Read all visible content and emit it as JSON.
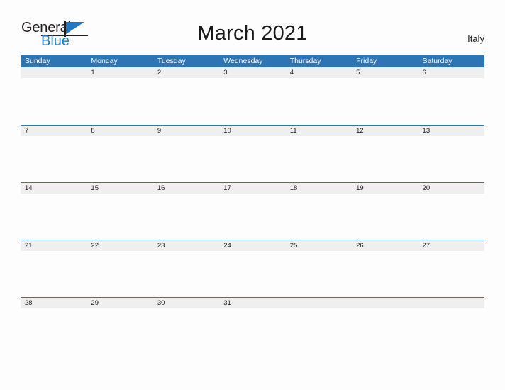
{
  "brand": {
    "word_one": "General",
    "word_two": "Blue",
    "flag_icon": "blue-flag-icon",
    "accent_color": "#1f78c1"
  },
  "header": {
    "title": "March 2021",
    "country": "Italy"
  },
  "calendar": {
    "header_bg": "#2e75b6",
    "date_band_bg": "#efefef",
    "weekdays": [
      "Sunday",
      "Monday",
      "Tuesday",
      "Wednesday",
      "Thursday",
      "Friday",
      "Saturday"
    ],
    "weeks": [
      [
        "",
        "1",
        "2",
        "3",
        "4",
        "5",
        "6"
      ],
      [
        "7",
        "8",
        "9",
        "10",
        "11",
        "12",
        "13"
      ],
      [
        "14",
        "15",
        "16",
        "17",
        "18",
        "19",
        "20"
      ],
      [
        "21",
        "22",
        "23",
        "24",
        "25",
        "26",
        "27"
      ],
      [
        "28",
        "29",
        "30",
        "31",
        "",
        "",
        ""
      ]
    ]
  }
}
